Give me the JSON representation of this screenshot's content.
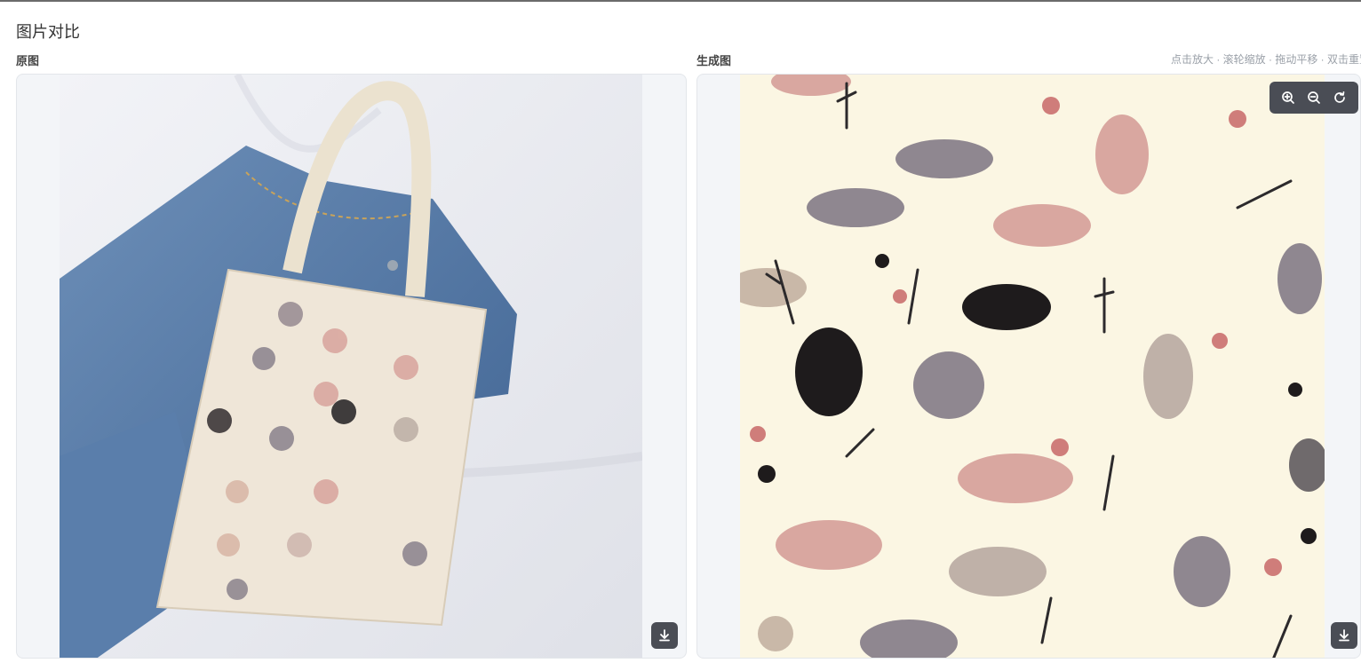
{
  "page": {
    "title": "图片对比"
  },
  "left": {
    "label": "原图",
    "download_icon": "download-icon"
  },
  "right": {
    "label": "生成图",
    "hint": "点击放大 · 滚轮缩放 · 拖动平移 · 双击重置",
    "zoom_in_icon": "zoom-in-icon",
    "zoom_out_icon": "zoom-out-icon",
    "reset_icon": "rotate-icon",
    "download_icon": "download-icon"
  },
  "colors": {
    "panel_bg": "#f3f5f8",
    "toolbar_bg": "#4a4d55",
    "pattern_bg": "#fbf6e3",
    "denim": "#5c7fa8",
    "bag": "#efe6d8"
  }
}
